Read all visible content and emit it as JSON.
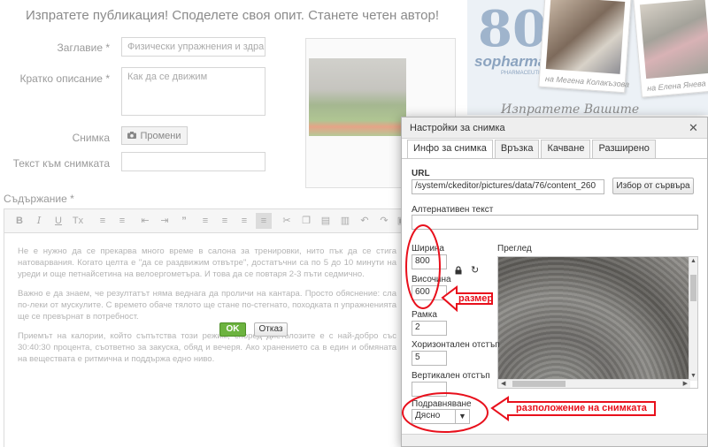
{
  "form": {
    "heading": "Изпратете публикация! Споделете своя опит. Станете четен автор!",
    "title_label": "Заглавие *",
    "title_value": "Физически упражнения и здравс",
    "short_desc_label": "Кратко описание *",
    "short_desc_value": "Как да се движим",
    "image_label": "Снимка",
    "change_button": "Промени",
    "image_text_label": "Текст към снимката",
    "content_label": "Съдържание *"
  },
  "editor": {
    "paragraphs": [
      "Не е нужно да се прекарва много време в салона за тренировки, нито пък да се стига натоварвания. Когато целта е \"да се раздвижим отвътре\", достатъчни са по 5 до 10 минути на уреди и още петнайсетина на велоергометъра. И това да се повтаря 2-3 пъти седмично.",
      "Важно е да знаем, че резултатът няма веднага да проличи на кантара. Просто обяснение: сла по-леки от мускулите. С времето обаче тялото ще стане по-стегнато, походката п упражненията ще се превърнат в потребност.",
      "Приемът на калории, който съпътства този режим, според диетолозите е с най-добро със 30:40:30 процента, съответно за закуска, обяд и вечеря. Ако хранението са в един и обмяната на веществата е ритмична и поддържа едно ниво."
    ]
  },
  "sidebar": {
    "brand": "sopharma",
    "brand_sub": "PHARMACEUTICALS",
    "caption_1": "Мегена Колакъзова",
    "caption_2": "Елена Янева",
    "script_text": "Изпратете Вашите"
  },
  "dialog": {
    "title": "Настройки за снимка",
    "close_glyph": "✕",
    "tabs": [
      "Инфо за снимка",
      "Връзка",
      "Качване",
      "Разширено"
    ],
    "url_label": "URL",
    "url_value": "/system/ckeditor/pictures/data/76/content_260",
    "browse_button": "Избор от сървъра",
    "alt_label": "Алтернативен текст",
    "alt_value": "",
    "width_label": "Ширина",
    "width_value": "800",
    "height_label": "Височина",
    "height_value": "600",
    "preview_label": "Преглед",
    "border_label": "Рамка",
    "border_value": "2",
    "hspace_label": "Хоризонтален отстъп",
    "hspace_value": "5",
    "vspace_label": "Вертикален отстъп",
    "vspace_value": "",
    "align_label": "Подравняване",
    "align_value": "Дясно",
    "ok_button": "OK",
    "cancel_button": "Отказ"
  },
  "annotations": {
    "size_label": "размер",
    "position_label": "разположение на снимката",
    "color": "#e8101c"
  }
}
